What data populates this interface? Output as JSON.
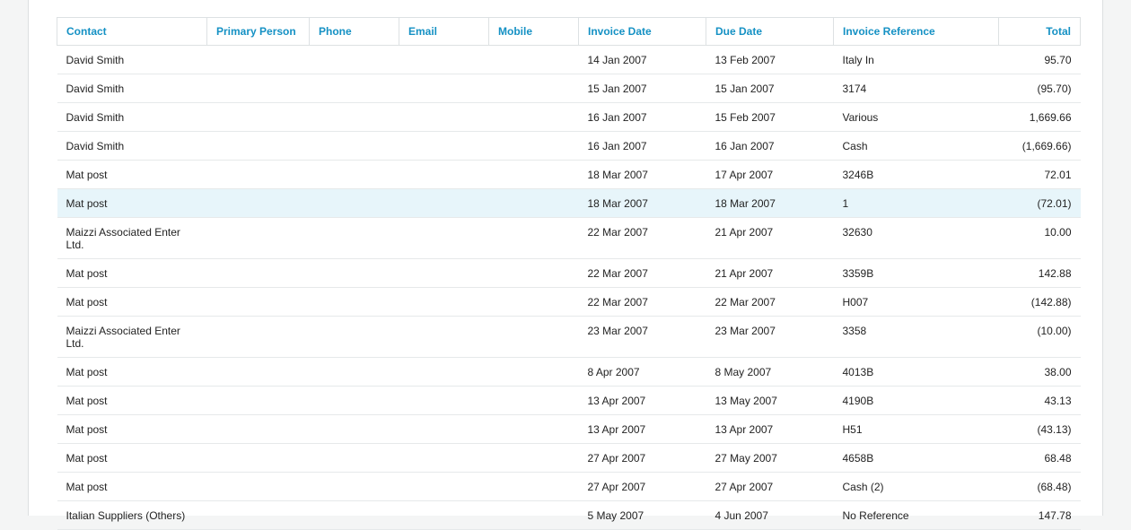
{
  "table": {
    "columns": [
      "Contact",
      "Primary Person",
      "Phone",
      "Email",
      "Mobile",
      "Invoice Date",
      "Due Date",
      "Invoice Reference",
      "Total"
    ],
    "highlighted_row": 5,
    "rows": [
      {
        "contact": "David Smith",
        "primary_person": "",
        "phone": "",
        "email": "",
        "mobile": "",
        "invoice_date": "14 Jan 2007",
        "due_date": "13 Feb 2007",
        "reference": "Italy In",
        "total": "95.70"
      },
      {
        "contact": "David Smith",
        "primary_person": "",
        "phone": "",
        "email": "",
        "mobile": "",
        "invoice_date": "15 Jan 2007",
        "due_date": "15 Jan 2007",
        "reference": "3174",
        "total": "(95.70)"
      },
      {
        "contact": "David Smith",
        "primary_person": "",
        "phone": "",
        "email": "",
        "mobile": "",
        "invoice_date": "16 Jan 2007",
        "due_date": "15 Feb 2007",
        "reference": "Various",
        "total": "1,669.66"
      },
      {
        "contact": "David Smith",
        "primary_person": "",
        "phone": "",
        "email": "",
        "mobile": "",
        "invoice_date": "16 Jan 2007",
        "due_date": "16 Jan 2007",
        "reference": "Cash",
        "total": "(1,669.66)"
      },
      {
        "contact": "Mat post",
        "primary_person": "",
        "phone": "",
        "email": "",
        "mobile": "",
        "invoice_date": "18 Mar 2007",
        "due_date": "17 Apr 2007",
        "reference": "3246B",
        "total": "72.01"
      },
      {
        "contact": "Mat post",
        "primary_person": "",
        "phone": "",
        "email": "",
        "mobile": "",
        "invoice_date": "18 Mar 2007",
        "due_date": "18 Mar 2007",
        "reference": "1",
        "total": "(72.01)"
      },
      {
        "contact": "Maizzi Associated Enter Ltd.",
        "primary_person": "",
        "phone": "",
        "email": "",
        "mobile": "",
        "invoice_date": "22 Mar 2007",
        "due_date": "21 Apr 2007",
        "reference": "32630",
        "total": "10.00"
      },
      {
        "contact": "Mat post",
        "primary_person": "",
        "phone": "",
        "email": "",
        "mobile": "",
        "invoice_date": "22 Mar 2007",
        "due_date": "21 Apr 2007",
        "reference": "3359B",
        "total": "142.88"
      },
      {
        "contact": "Mat post",
        "primary_person": "",
        "phone": "",
        "email": "",
        "mobile": "",
        "invoice_date": "22 Mar 2007",
        "due_date": "22 Mar 2007",
        "reference": "H007",
        "total": "(142.88)"
      },
      {
        "contact": "Maizzi Associated Enter Ltd.",
        "primary_person": "",
        "phone": "",
        "email": "",
        "mobile": "",
        "invoice_date": "23 Mar 2007",
        "due_date": "23 Mar 2007",
        "reference": "3358",
        "total": "(10.00)"
      },
      {
        "contact": "Mat post",
        "primary_person": "",
        "phone": "",
        "email": "",
        "mobile": "",
        "invoice_date": "8 Apr 2007",
        "due_date": "8 May 2007",
        "reference": "4013B",
        "total": "38.00"
      },
      {
        "contact": "Mat post",
        "primary_person": "",
        "phone": "",
        "email": "",
        "mobile": "",
        "invoice_date": "13 Apr 2007",
        "due_date": "13 May 2007",
        "reference": "4190B",
        "total": "43.13"
      },
      {
        "contact": "Mat post",
        "primary_person": "",
        "phone": "",
        "email": "",
        "mobile": "",
        "invoice_date": "13 Apr 2007",
        "due_date": "13 Apr 2007",
        "reference": "H51",
        "total": "(43.13)"
      },
      {
        "contact": "Mat post",
        "primary_person": "",
        "phone": "",
        "email": "",
        "mobile": "",
        "invoice_date": "27 Apr 2007",
        "due_date": "27 May 2007",
        "reference": "4658B",
        "total": "68.48"
      },
      {
        "contact": "Mat post",
        "primary_person": "",
        "phone": "",
        "email": "",
        "mobile": "",
        "invoice_date": "27 Apr 2007",
        "due_date": "27 Apr 2007",
        "reference": "Cash (2)",
        "total": "(68.48)"
      },
      {
        "contact": "Italian Suppliers (Others)",
        "primary_person": "",
        "phone": "",
        "email": "",
        "mobile": "",
        "invoice_date": "5 May 2007",
        "due_date": "4 Jun 2007",
        "reference": "No Reference",
        "total": "147.78"
      }
    ]
  }
}
